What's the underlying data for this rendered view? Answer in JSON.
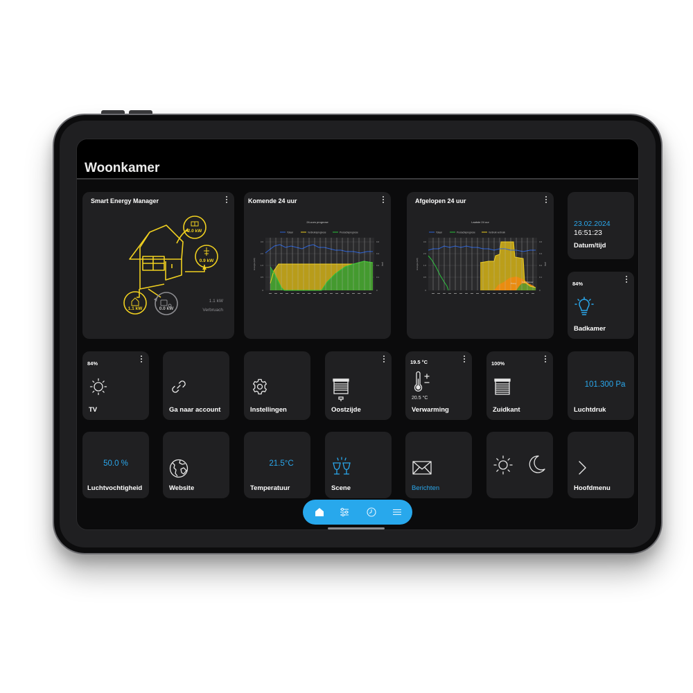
{
  "page": {
    "title": "Woonkamer"
  },
  "colors": {
    "accent": "#28a8ec",
    "card": "#202022",
    "energy_yellow": "#f0d020",
    "chart_blue": "#2b63d8",
    "chart_green": "#28c43a",
    "chart_orange": "#f08a10"
  },
  "energy_card": {
    "title": "Smart Energy Manager",
    "solar": "2.0 kW",
    "grid": "0.9 kW",
    "house": "1.1 kW",
    "car": "0.0 kW",
    "consumption_value": "1.1 kW",
    "consumption_label": "Verbruach"
  },
  "next24_card": {
    "title": "Komende 24 uur",
    "chart_title": "24-uurs prognose",
    "legend": [
      "Totaal",
      "Verbruiksprognose",
      "Productieprognose"
    ],
    "ylabel_left": "Energie (kW)",
    "ylabel_right": "(kW)"
  },
  "last24_card": {
    "title": "Afgelopen 24 uur",
    "chart_title": "Laatste 24 uur",
    "legend": [
      "Totaal",
      "Productieprognose",
      "Verbruik verbruik"
    ],
    "ylabel_left": "Energie (kW)",
    "ylabel_right": "(kW)",
    "annotations": [
      "Pomp",
      "Car Charger"
    ]
  },
  "datetime_card": {
    "date": "23.02.2024",
    "time": "16:51:23",
    "label": "Datum/tijd"
  },
  "bathroom_card": {
    "percent": "84%",
    "label": "Badkamer",
    "icon": "lightbulb-icon"
  },
  "tiles_row1": [
    {
      "id": "tv",
      "percent": "84%",
      "label": "TV",
      "icon": "sun-dimmer-icon"
    },
    {
      "id": "account",
      "label": "Ga naar account",
      "icon": "link-icon"
    },
    {
      "id": "settings",
      "label": "Instellingen",
      "icon": "gear-icon"
    },
    {
      "id": "east",
      "label": "Oostzijde",
      "icon": "blind-icon"
    },
    {
      "id": "heating",
      "setpoint": "19.5 °C",
      "current": "20.5 °C",
      "label": "Verwarming",
      "icon": "thermometer-icon"
    },
    {
      "id": "south",
      "percent": "100%",
      "label": "Zuidkant",
      "icon": "blind-icon"
    },
    {
      "id": "pressure",
      "value": "101.300 Pa",
      "label": "Luchtdruk"
    }
  ],
  "tiles_row2": [
    {
      "id": "humidity",
      "value": "50.0 %",
      "label": "Luchtvochtigheid"
    },
    {
      "id": "website",
      "label": "Website",
      "icon": "globe-icon"
    },
    {
      "id": "temperature",
      "value": "21.5°C",
      "label": "Temperatuur"
    },
    {
      "id": "scene",
      "label": "Scene",
      "icon": "glasses-icon"
    },
    {
      "id": "messages",
      "label": "Berichten",
      "icon": "envelope-icon"
    },
    {
      "id": "daynight",
      "icons": [
        "sun-icon",
        "moon-icon"
      ]
    },
    {
      "id": "mainmenu",
      "label": "Hoofdmenu",
      "icon": "chevron-right-icon"
    }
  ],
  "nav": {
    "items": [
      {
        "id": "home",
        "icon": "home-icon",
        "active": true
      },
      {
        "id": "controls",
        "icon": "sliders-icon"
      },
      {
        "id": "timer",
        "icon": "clock-icon"
      },
      {
        "id": "menu",
        "icon": "menu-icon"
      }
    ]
  }
}
